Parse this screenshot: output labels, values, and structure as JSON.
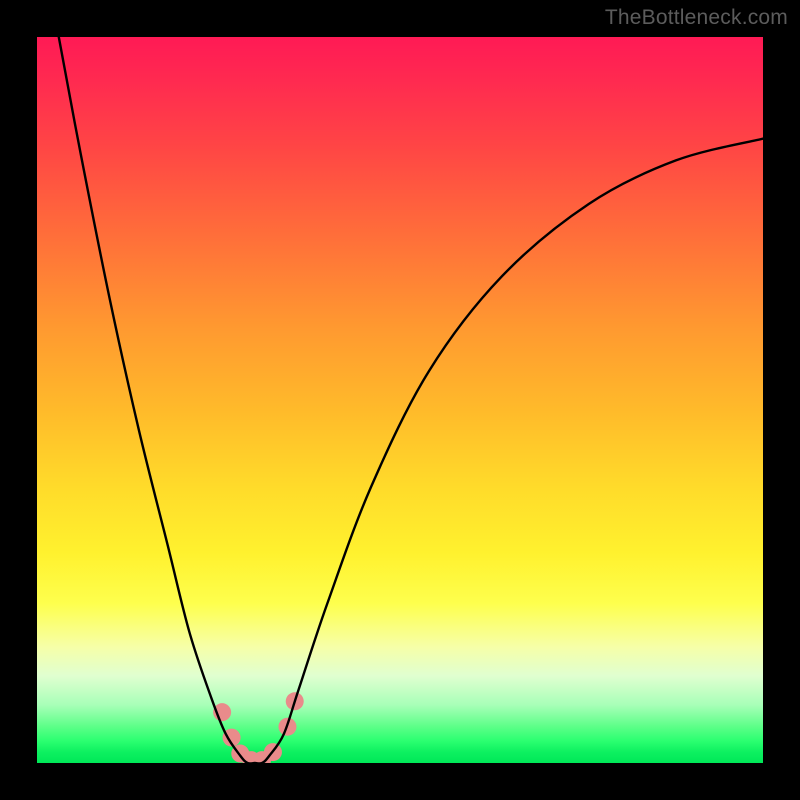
{
  "watermark": "TheBottleneck.com",
  "chart_data": {
    "type": "line",
    "title": "",
    "xlabel": "",
    "ylabel": "",
    "xlim": [
      0,
      100
    ],
    "ylim": [
      0,
      100
    ],
    "grid": false,
    "legend": false,
    "series": [
      {
        "name": "bottleneck-curve",
        "color": "#000000",
        "x": [
          3,
          6,
          10,
          14,
          18,
          21,
          24,
          26,
          28,
          29,
          30,
          31,
          32,
          34,
          36,
          40,
          46,
          54,
          64,
          76,
          88,
          100
        ],
        "y": [
          100,
          84,
          64,
          46,
          30,
          18,
          9,
          4,
          1,
          0,
          0,
          0,
          1,
          4,
          10,
          22,
          38,
          54,
          67,
          77,
          83,
          86
        ]
      }
    ],
    "markers": [
      {
        "name": "highlight-dots",
        "color": "#e98b8b",
        "points": [
          {
            "x": 25.5,
            "y": 7.0
          },
          {
            "x": 26.8,
            "y": 3.5
          },
          {
            "x": 28.0,
            "y": 1.3
          },
          {
            "x": 29.5,
            "y": 0.4
          },
          {
            "x": 31.0,
            "y": 0.4
          },
          {
            "x": 32.5,
            "y": 1.5
          },
          {
            "x": 34.5,
            "y": 5.0
          },
          {
            "x": 35.5,
            "y": 8.5
          }
        ]
      }
    ],
    "gradient_bands": [
      {
        "y": 100,
        "color": "#ff1a55"
      },
      {
        "y": 50,
        "color": "#ffbc2a"
      },
      {
        "y": 20,
        "color": "#fff740"
      },
      {
        "y": 0,
        "color": "#00e858"
      }
    ]
  }
}
